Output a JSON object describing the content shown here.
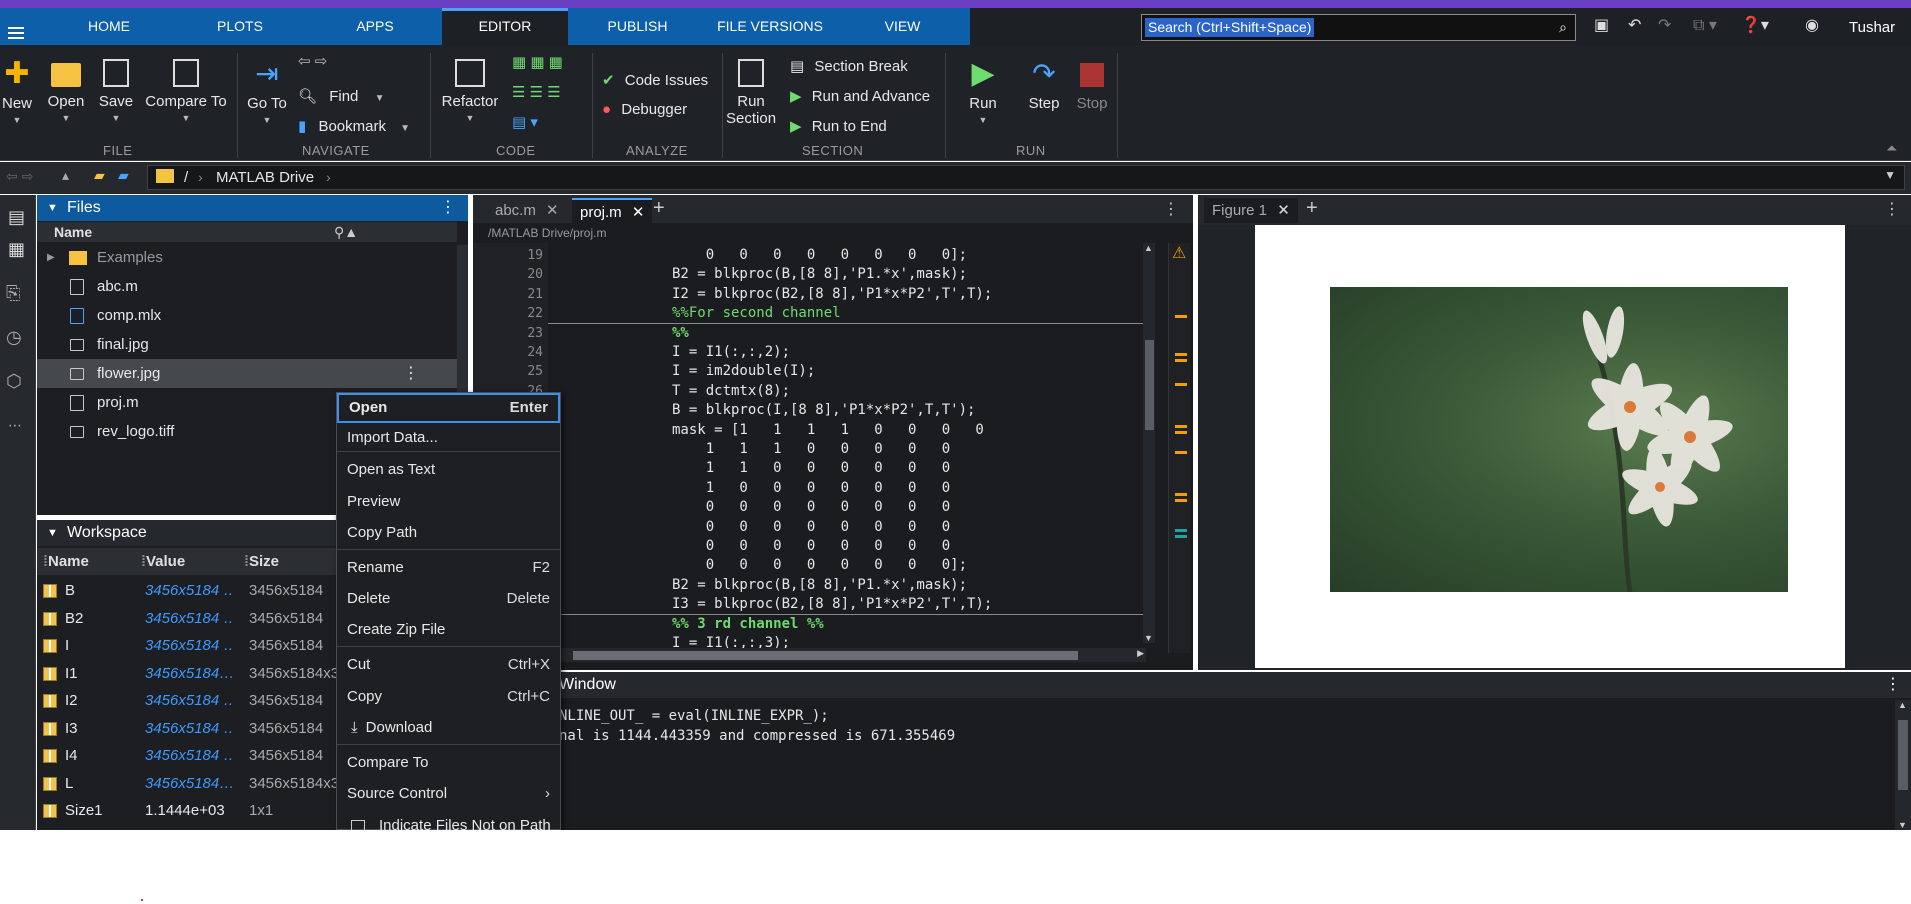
{
  "topbar": {
    "tabs": [
      "HOME",
      "PLOTS",
      "APPS",
      "EDITOR",
      "PUBLISH",
      "FILE VERSIONS",
      "VIEW"
    ],
    "search_placeholder": "Search (Ctrl+Shift+Space)",
    "user": "Tushar"
  },
  "ribbon": {
    "file": {
      "new": "New",
      "open": "Open",
      "save": "Save",
      "compare": "Compare To",
      "label": "FILE"
    },
    "navigate": {
      "goto": "Go To",
      "find": "Find",
      "bookmark": "Bookmark",
      "label": "NAVIGATE"
    },
    "code": {
      "refactor": "Refactor",
      "label": "CODE"
    },
    "analyze": {
      "issues": "Code Issues",
      "debugger": "Debugger",
      "label": "ANALYZE"
    },
    "section": {
      "run_section_1": "Run",
      "run_section_2": "Section",
      "section_break": "Section Break",
      "run_advance": "Run and Advance",
      "run_to_end": "Run to End",
      "label": "SECTION"
    },
    "run": {
      "run": "Run",
      "step": "Step",
      "stop": "Stop",
      "label": "RUN"
    }
  },
  "address": {
    "root": "/",
    "drive": "MATLAB Drive"
  },
  "files": {
    "title": "Files",
    "col_name": "Name",
    "items": [
      "Examples",
      "abc.m",
      "comp.mlx",
      "final.jpg",
      "flower.jpg",
      "proj.m",
      "rev_logo.tiff"
    ]
  },
  "workspace": {
    "title": "Workspace",
    "cols": [
      "Name",
      "Value",
      "Size"
    ],
    "rows": [
      {
        "name": "B",
        "value": "3456x5184 …",
        "size": "3456x5184"
      },
      {
        "name": "B2",
        "value": "3456x5184 …",
        "size": "3456x5184"
      },
      {
        "name": "I",
        "value": "3456x5184 …",
        "size": "3456x5184"
      },
      {
        "name": "I1",
        "value": "3456x5184…",
        "size": "3456x5184x3"
      },
      {
        "name": "I2",
        "value": "3456x5184 …",
        "size": "3456x5184"
      },
      {
        "name": "I3",
        "value": "3456x5184 …",
        "size": "3456x5184"
      },
      {
        "name": "I4",
        "value": "3456x5184 …",
        "size": "3456x5184"
      },
      {
        "name": "L",
        "value": "3456x5184…",
        "size": "3456x5184x3"
      },
      {
        "name": "Size1",
        "value": "1.1444e+03",
        "size": "1x1"
      }
    ]
  },
  "editor": {
    "tabs": [
      "abc.m",
      "proj.m"
    ],
    "path": "/MATLAB Drive/proj.m",
    "lines": [
      {
        "n": "19",
        "code": "    0   0   0   0   0   0   0   0];",
        "kind": "code"
      },
      {
        "n": "20",
        "code": "B2 = blkproc(B,[8 8],'P1.*x',mask);",
        "kind": "code"
      },
      {
        "n": "21",
        "code": "I2 = blkproc(B2,[8 8],'P1*x*P2',T',T);",
        "kind": "code"
      },
      {
        "n": "22",
        "code": "%%For second channel",
        "kind": "comment"
      },
      {
        "n": "23",
        "code": "%%",
        "kind": "bold"
      },
      {
        "n": "24",
        "code": "I = I1(:,:,2);",
        "kind": "code"
      },
      {
        "n": "25",
        "code": "I = im2double(I);",
        "kind": "code"
      },
      {
        "n": "26",
        "code": "T = dctmtx(8);",
        "kind": "code"
      },
      {
        "n": "27",
        "code": "B = blkproc(I,[8 8],'P1*x*P2',T,T');",
        "kind": "code"
      },
      {
        "n": "28",
        "code": "mask = [1   1   1   1   0   0   0   0",
        "kind": "code"
      },
      {
        "n": "29",
        "code": "    1   1   1   0   0   0   0   0",
        "kind": "code"
      },
      {
        "n": "30",
        "code": "    1   1   0   0   0   0   0   0",
        "kind": "code"
      },
      {
        "n": "31",
        "code": "    1   0   0   0   0   0   0   0",
        "kind": "code"
      },
      {
        "n": "32",
        "code": "    0   0   0   0   0   0   0   0",
        "kind": "code"
      },
      {
        "n": "33",
        "code": "    0   0   0   0   0   0   0   0",
        "kind": "code"
      },
      {
        "n": "34",
        "code": "    0   0   0   0   0   0   0   0",
        "kind": "code"
      },
      {
        "n": "35",
        "code": "    0   0   0   0   0   0   0   0];",
        "kind": "code"
      },
      {
        "n": "36",
        "code": "B2 = blkproc(B,[8 8],'P1.*x',mask);",
        "kind": "code"
      },
      {
        "n": "37",
        "code": "I3 = blkproc(B2,[8 8],'P1*x*P2',T',T);",
        "kind": "code"
      },
      {
        "n": "38",
        "code": "%% 3 rd channel %%",
        "kind": "bold"
      },
      {
        "n": "39",
        "code": "I = I1(:,:,3);",
        "kind": "code"
      }
    ]
  },
  "figure": {
    "tab": "Figure 1"
  },
  "command": {
    "title": "Window",
    "lines": [
      "NLINE_OUT_ = eval(INLINE_EXPR_);",
      "nal is 1144.443359 and compressed is 671.355469"
    ]
  },
  "context_menu": {
    "items": [
      {
        "label": "Open",
        "shortcut": "Enter"
      },
      {
        "label": "Import Data...",
        "shortcut": ""
      },
      {
        "label": "Open as Text",
        "shortcut": ""
      },
      {
        "label": "Preview",
        "shortcut": ""
      },
      {
        "label": "Copy Path",
        "shortcut": ""
      },
      {
        "label": "Rename",
        "shortcut": "F2"
      },
      {
        "label": "Delete",
        "shortcut": "Delete"
      },
      {
        "label": "Create Zip File",
        "shortcut": ""
      },
      {
        "label": "Cut",
        "shortcut": "Ctrl+X"
      },
      {
        "label": "Copy",
        "shortcut": "Ctrl+C"
      },
      {
        "label": "Download",
        "shortcut": ""
      },
      {
        "label": "Compare To",
        "shortcut": ""
      },
      {
        "label": "Source Control",
        "shortcut": "›"
      },
      {
        "label": "Indicate Files Not on Path",
        "shortcut": ""
      }
    ]
  }
}
